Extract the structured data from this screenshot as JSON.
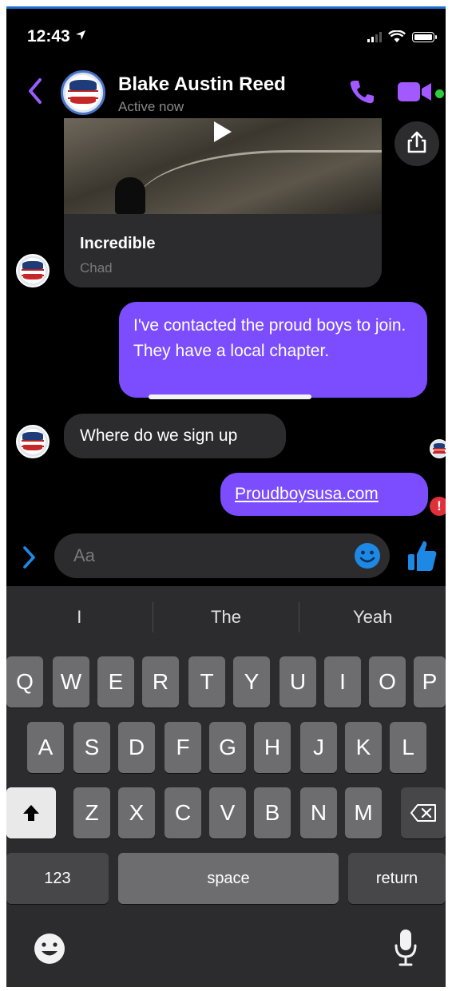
{
  "status": {
    "time": "12:43"
  },
  "header": {
    "contact_name": "Blake Austin Reed",
    "presence": "Active now"
  },
  "messages": {
    "media_card": {
      "title": "Incredible",
      "subtitle": "Chad"
    },
    "sent_1": "I've contacted the proud boys to join. They have a local chapter.",
    "received_1": "Where do we sign up",
    "sent_2": "Proudboysusa.com",
    "error_mark": "!"
  },
  "composer": {
    "placeholder": "Aa"
  },
  "keyboard": {
    "suggestions": [
      "I",
      "The",
      "Yeah"
    ],
    "row1": [
      "Q",
      "W",
      "E",
      "R",
      "T",
      "Y",
      "U",
      "I",
      "O",
      "P"
    ],
    "row2": [
      "A",
      "S",
      "D",
      "F",
      "G",
      "H",
      "J",
      "K",
      "L"
    ],
    "row3": [
      "Z",
      "X",
      "C",
      "V",
      "B",
      "N",
      "M"
    ],
    "numbers_label": "123",
    "space_label": "space",
    "return_label": "return"
  },
  "colors": {
    "accent": "#7c4dff",
    "bubble_in": "#2c2c2e",
    "online": "#2ecc40",
    "error": "#e0303a",
    "link_blue": "#1e88e5"
  },
  "icons": [
    "back-chevron-icon",
    "phone-icon",
    "video-camera-icon",
    "share-icon",
    "expand-chevron-icon",
    "smiley-icon",
    "thumbs-up-icon",
    "shift-arrow-icon",
    "backspace-icon",
    "emoji-keyboard-icon",
    "microphone-icon"
  ]
}
